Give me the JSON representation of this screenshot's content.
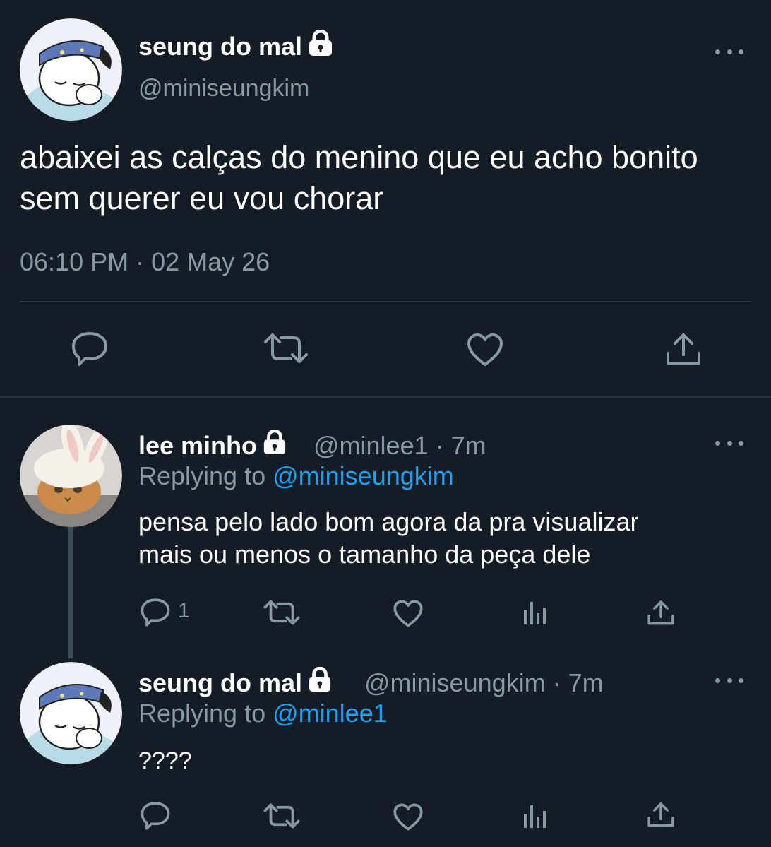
{
  "main_tweet": {
    "display_name": "seung do mal",
    "handle": "@miniseungkim",
    "text": "abaixei as calças do menino que eu acho bonito sem querer eu vou chorar",
    "timestamp": "06:10 PM · 02 May 26",
    "avatar": "cartoon-sleeping-dog-avatar",
    "locked": true
  },
  "replies": [
    {
      "display_name": "lee minho",
      "handle": "@minlee1",
      "age": "7m",
      "meta": "@minlee1 · 7m",
      "replying_label": "Replying to",
      "replying_to": "@miniseungkim",
      "text_line1": "pensa pelo lado bom agora da pra visualizar",
      "text_line2": "mais ou menos o tamanho da peça dele",
      "reply_count": "1",
      "avatar": "cat-in-bunny-hat-avatar",
      "locked": true
    },
    {
      "display_name": "seung do mal",
      "handle": "@miniseungkim",
      "age": "7m",
      "meta": "@miniseungkim · 7m",
      "replying_label": "Replying to",
      "replying_to": "@minlee1",
      "text": "????",
      "avatar": "cartoon-sleeping-dog-avatar",
      "locked": true
    }
  ],
  "colors": {
    "background": "#141d26",
    "secondary_text": "#8899a6",
    "link": "#1da1f2",
    "icon": "#8899a6"
  },
  "icons": {
    "reply": "reply-icon",
    "retweet": "retweet-icon",
    "like": "like-icon",
    "share": "share-icon",
    "analytics": "analytics-icon",
    "more": "more-options-icon",
    "lock": "lock-icon"
  }
}
